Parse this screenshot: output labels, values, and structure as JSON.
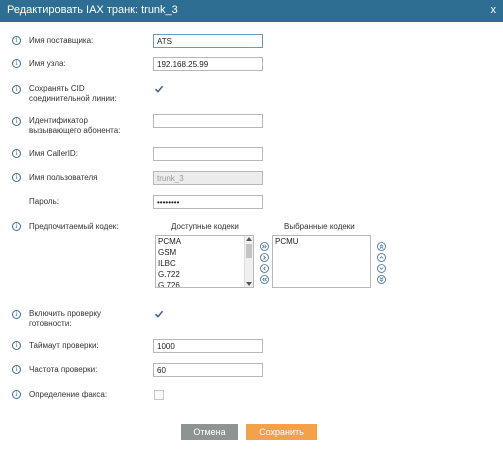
{
  "dialog": {
    "title": "Редактировать IAX транк: trunk_3",
    "close": "x"
  },
  "form": {
    "provider_label": "Имя поставщика:",
    "provider_value": "ATS",
    "host_label": "Имя узла:",
    "host_value": "192.168.25.99",
    "keep_cid_label_line1": "Сохранять CID",
    "keep_cid_label_line2": "соединительной линии:",
    "keep_cid_checked": true,
    "caller_id_label_line1": "Идентификатор",
    "caller_id_label_line2": "вызывающего абонента:",
    "caller_id_value": "",
    "caller_name_label": "Имя CallerID:",
    "caller_name_value": "",
    "username_label": "Имя пользователя",
    "username_value": "trunk_3",
    "password_label": "Пароль:",
    "password_value": "••••••••",
    "codec_label": "Предпочитаемый кодек:",
    "available_header": "Доступные кодеки",
    "selected_header": "Выбранные кодеки",
    "available_codecs": [
      "PCMA",
      "GSM",
      "ILBC",
      "G.722",
      "G.726"
    ],
    "selected_codecs": [
      "PCMU"
    ],
    "qualify_label_line1": "Включить проверку",
    "qualify_label_line2": "готовности:",
    "qualify_checked": true,
    "qualify_timeout_label": "Таймаут проверки:",
    "qualify_timeout_value": "1000",
    "qualify_freq_label": "Частота проверки:",
    "qualify_freq_value": "60",
    "fax_label": "Определение факса:",
    "fax_checked": false
  },
  "buttons": {
    "cancel": "Отмена",
    "save": "Сохранить"
  },
  "colors": {
    "titlebar": "#2f6e93",
    "cancel": "#8e9393",
    "save": "#f5a14a",
    "icon": "#3c6e9a"
  },
  "icons": {
    "info": "info-circle-icon",
    "check": "checkmark-icon",
    "move_all_right": "double-chevron-right-icon",
    "move_right": "chevron-right-icon",
    "move_left": "chevron-left-icon",
    "move_all_left": "double-chevron-left-icon",
    "move_top": "double-chevron-up-icon",
    "move_up": "chevron-up-icon",
    "move_down": "chevron-down-icon",
    "move_bottom": "double-chevron-down-icon"
  }
}
